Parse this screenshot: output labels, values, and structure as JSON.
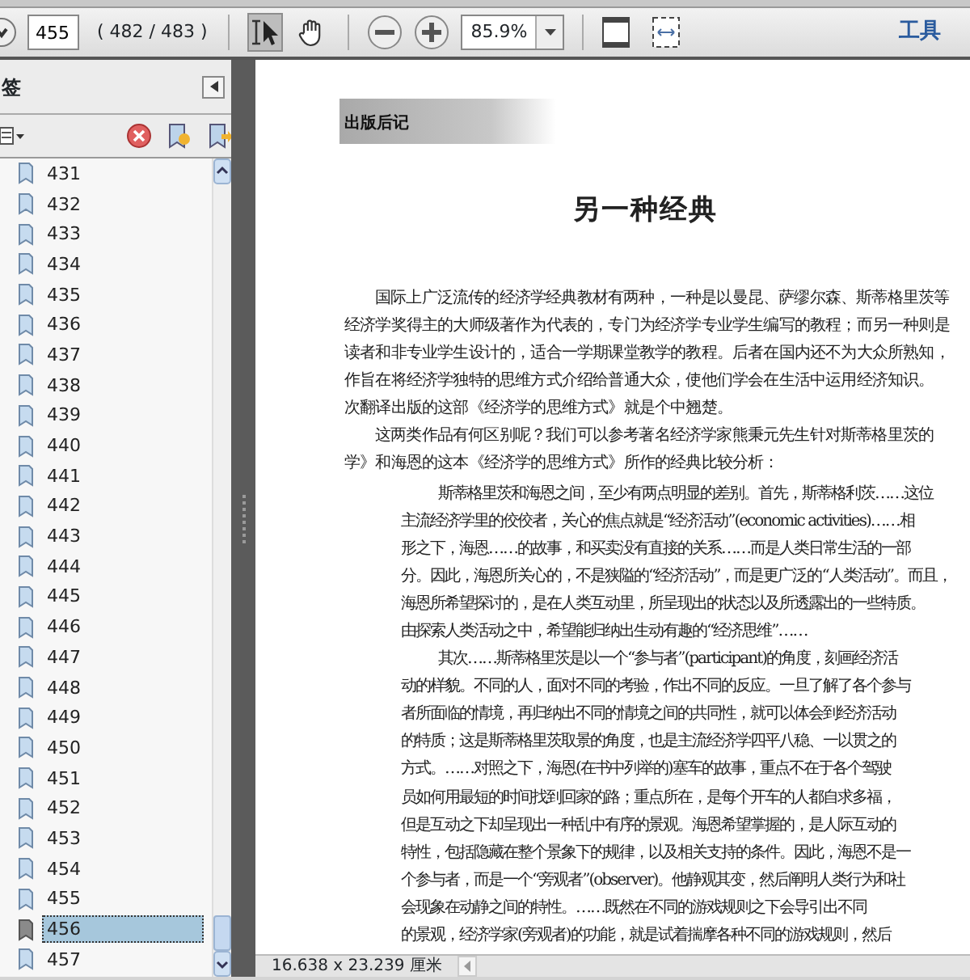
{
  "toolbar": {
    "page_field": "455",
    "page_count": "( 482 / 483 )",
    "tools": [
      {
        "kind": "select",
        "selected": true
      },
      {
        "kind": "hand",
        "selected": false
      }
    ],
    "zoom": "85.9%",
    "tools_label": "工具"
  },
  "sidebar": {
    "title": "签",
    "bookmarks": [
      {
        "label": "431",
        "selected": false
      },
      {
        "label": "432",
        "selected": false
      },
      {
        "label": "433",
        "selected": false
      },
      {
        "label": "434",
        "selected": false
      },
      {
        "label": "435",
        "selected": false
      },
      {
        "label": "436",
        "selected": false
      },
      {
        "label": "437",
        "selected": false
      },
      {
        "label": "438",
        "selected": false
      },
      {
        "label": "439",
        "selected": false
      },
      {
        "label": "440",
        "selected": false
      },
      {
        "label": "441",
        "selected": false
      },
      {
        "label": "442",
        "selected": false
      },
      {
        "label": "443",
        "selected": false
      },
      {
        "label": "444",
        "selected": false
      },
      {
        "label": "445",
        "selected": false
      },
      {
        "label": "446",
        "selected": false
      },
      {
        "label": "447",
        "selected": false
      },
      {
        "label": "448",
        "selected": false
      },
      {
        "label": "449",
        "selected": false
      },
      {
        "label": "450",
        "selected": false
      },
      {
        "label": "451",
        "selected": false
      },
      {
        "label": "452",
        "selected": false
      },
      {
        "label": "453",
        "selected": false
      },
      {
        "label": "454",
        "selected": false
      },
      {
        "label": "455",
        "selected": false
      },
      {
        "label": "456",
        "selected": true
      },
      {
        "label": "457",
        "selected": false
      }
    ]
  },
  "document": {
    "section_label": "出版后记",
    "title": "另一种经典",
    "paragraphs": [
      {
        "kind": "body",
        "lines": [
          "国际上广泛流传的经济学经典教材有两种，一种是以曼昆、萨缪尔森、斯蒂格里茨等",
          "经济学奖得主的大师级著作为代表的，专门为经济学专业学生编写的教程；而另一种则是",
          "读者和非专业学生设计的，适合一学期课堂教学的教程。后者在国内还不为大众所熟知，",
          "作旨在将经济学独特的思维方式介绍给普通大众，使他们学会在生活中运用经济知识。",
          "次翻译出版的这部《经济学的思维方式》就是个中翘楚。"
        ]
      },
      {
        "kind": "body",
        "lines": [
          "这两类作品有何区别呢？我们可以参考著名经济学家熊秉元先生针对斯蒂格里茨的",
          "学》和海恩的这本《经济学的思维方式》所作的经典比较分析："
        ]
      },
      {
        "kind": "quote",
        "lines": [
          "斯蒂格里茨和海恩之间，至少有两点明显的差别。首先，斯蒂格利茨……这位",
          "主流经济学里的佼佼者，关心的焦点就是“经济活动”(economic activities)……相",
          "形之下，海恩……的故事，和买卖没有直接的关系……而是人类日常生活的一部",
          "分。因此，海恩所关心的，不是狭隘的“经济活动”，而是更广泛的“人类活动”。而且，",
          "海恩所希望探讨的，是在人类互动里，所呈现出的状态以及所透露出的一些特质。",
          "由探索人类活动之中，希望能归纳出生动有趣的“经济思维”……"
        ]
      },
      {
        "kind": "quote",
        "lines": [
          "其次……斯蒂格里茨是以一个“参与者”(participant)的角度，刻画经济活",
          "动的样貌。不同的人，面对不同的考验，作出不同的反应。一旦了解了各个参与",
          "者所面临的情境，再归纳出不同的情境之间的共同性，就可以体会到经济活动",
          "的特质；这是斯蒂格里茨取景的角度，也是主流经济学四平八稳、一以贯之的",
          "方式。……对照之下，海恩(在书中列举的)塞车的故事，重点不在于各个驾驶",
          "员如何用最短的时间找到回家的路；重点所在，是每个开车的人都自求多福，",
          "但是互动之下却呈现出一种乱中有序的景观。海恩希望掌握的，是人际互动的",
          "特性，包括隐藏在整个景象下的规律，以及相关支持的条件。因此，海恩不是一",
          "个参与者，而是一个“旁观者”(observer)。他静观其变，然后阐明人类行为和社",
          "会现象在动静之间的特性。……既然在不同的游戏规则之下会导引出不同",
          "的景观，经济学家(旁观者)的功能，就是试着揣摩各种不同的游戏规则，然后"
        ]
      }
    ]
  },
  "status_bar": {
    "page_size": "16.638 x 23.239 厘米"
  }
}
